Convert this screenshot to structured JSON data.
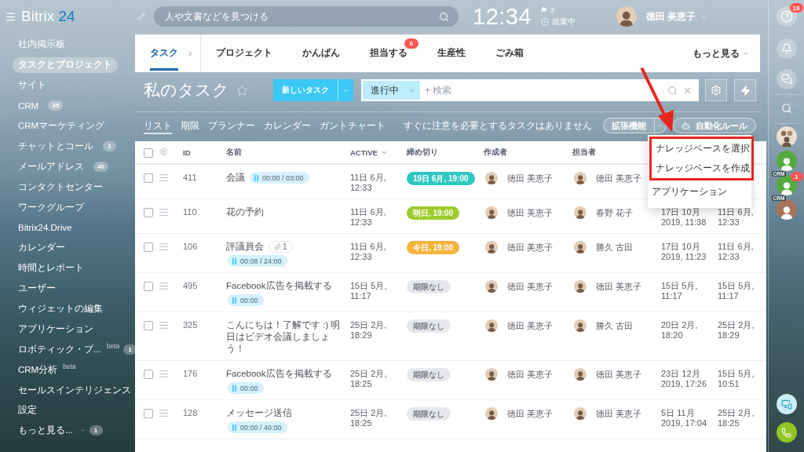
{
  "topbar": {
    "logo_word": "Bitrix",
    "logo_number": "24",
    "search": {
      "placeholder": "人や文書などを見つける"
    },
    "clock": "12:34",
    "flag_count": "3",
    "work_status": "就業中",
    "user_name": "徳田 美恵子"
  },
  "sidebar": {
    "items": [
      {
        "label": "社内掲示板",
        "kind": "link",
        "selected": false
      },
      {
        "label": "タスクとプロジェクト",
        "kind": "link",
        "selected": true
      },
      {
        "label": "サイト",
        "kind": "link",
        "selected": false
      },
      {
        "label": "CRM",
        "kind": "link",
        "selected": false,
        "counter": "35"
      },
      {
        "label": "CRMマーケティング",
        "kind": "link",
        "selected": false
      },
      {
        "label": "チャットとコール",
        "kind": "link",
        "selected": false,
        "counter": "1"
      },
      {
        "label": "メールアドレス",
        "kind": "link",
        "selected": false,
        "counter": "40"
      },
      {
        "label": "コンタクトセンター",
        "kind": "link",
        "selected": false
      },
      {
        "label": "ワークグループ",
        "kind": "link",
        "selected": false
      },
      {
        "label": "Bitrix24.Drive",
        "kind": "link",
        "selected": false
      },
      {
        "label": "カレンダー",
        "kind": "link",
        "selected": false
      },
      {
        "label": "時間とレポート",
        "kind": "link",
        "selected": false
      },
      {
        "label": "ユーザー",
        "kind": "link",
        "selected": false
      },
      {
        "label": "ウィジェットの編集",
        "kind": "link",
        "selected": false
      },
      {
        "label": "アプリケーション",
        "kind": "link",
        "selected": false
      },
      {
        "label": "ロボティック・プ...",
        "kind": "link",
        "selected": false,
        "tag": "beta",
        "counter": "1"
      },
      {
        "label": "CRM分析",
        "kind": "link",
        "selected": false,
        "tag": "beta"
      },
      {
        "label": "セールスインテリジェンス",
        "kind": "link",
        "selected": false
      },
      {
        "label": "設定",
        "kind": "link",
        "selected": false
      },
      {
        "label": "もっと見る...",
        "kind": "more",
        "selected": false,
        "counter": "1"
      }
    ]
  },
  "tabs": {
    "items": [
      {
        "label": "タスク",
        "kind": "root",
        "selected": true
      },
      {
        "label": "プロジェクト",
        "kind": "tab",
        "selected": false
      },
      {
        "label": "かんばん",
        "kind": "tab",
        "selected": false
      },
      {
        "label": "担当する",
        "kind": "tab",
        "selected": false,
        "counter": "6"
      },
      {
        "label": "生産性",
        "kind": "tab",
        "selected": false
      },
      {
        "label": "ごみ箱",
        "kind": "tab",
        "selected": false
      }
    ],
    "more": "もっと見る"
  },
  "toolbar": {
    "title": "私のタスク",
    "starred": false,
    "new_task_button": "新しいタスク",
    "filter": {
      "tags": [
        "進行中"
      ],
      "placeholder": "+ 検索"
    }
  },
  "views": {
    "items": [
      {
        "label": "リスト",
        "selected": true
      },
      {
        "label": "期限",
        "selected": false
      },
      {
        "label": "プランナー",
        "selected": false
      },
      {
        "label": "カレンダー",
        "selected": false
      },
      {
        "label": "ガントチャート",
        "selected": false
      }
    ],
    "notice": "すぐに注意を必要とするタスクはありません",
    "extensions_button": "拡張機能",
    "automation_button": "自動化ルール"
  },
  "dropdown": {
    "items": [
      {
        "label": "ナレッジベースを選択",
        "highlighted": true
      },
      {
        "label": "ナレッジベースを作成",
        "highlighted": true
      },
      {
        "label": "アプリケーション",
        "highlighted": false
      }
    ]
  },
  "table": {
    "select_all_checked": false,
    "columns": [
      {
        "label": "ID",
        "sorted": false
      },
      {
        "label": "名前",
        "sorted": false
      },
      {
        "label": "ACTIVE",
        "sorted": true
      },
      {
        "label": "締め切り",
        "sorted": false
      },
      {
        "label": "作成者",
        "sorted": false
      },
      {
        "label": "担当者",
        "sorted": false
      }
    ],
    "rows": [
      {
        "checked": false,
        "id": "411",
        "name": "会議",
        "timer": "00:00 / 03:00",
        "active": "11日 6月,\n12:33",
        "deadline": {
          "text": "19日 6月, 19:00",
          "color": "#2fc7c2"
        },
        "creator": "徳田 美恵子",
        "responsible": "徳田 美恵子"
      },
      {
        "checked": false,
        "id": "110",
        "name": "花の予約",
        "active": "11日 6月,\n12:33",
        "deadline": {
          "text": "明日, 19:00",
          "color": "#9ccb2c"
        },
        "creator": "徳田 美恵子",
        "responsible": "春野 花子",
        "column_7": "17日 10月\n2019, 11:38",
        "column_8": "11日 6月,\n12:33"
      },
      {
        "checked": false,
        "id": "106",
        "name": "評議員会",
        "attachments": "1",
        "timer": "00:08 / 24:00",
        "active": "11日 6月,\n12:33",
        "deadline": {
          "text": "今日, 19:00",
          "color": "#f4b33c"
        },
        "creator": "徳田 美恵子",
        "responsible": "勝久 古田",
        "column_7": "17日 10月\n2019, 11:23",
        "column_8": "11日 6月,\n12:33"
      },
      {
        "checked": false,
        "id": "495",
        "name": "Facebook広告を掲載する",
        "timer": "00:00",
        "active": "15日 5月,\n11:17",
        "deadline": {
          "text": "期限なし",
          "color": "#e6e8eb"
        },
        "creator": "徳田 美恵子",
        "responsible": "徳田 美恵子",
        "column_7": "15日 5月,\n11:17",
        "column_8": "15日 5月,\n11:17"
      },
      {
        "checked": false,
        "id": "325",
        "name": "こんにちは！了解です :) 明日はビデオ会議しましょう！",
        "active": "25日 2月,\n18:29",
        "deadline": {
          "text": "期限なし",
          "color": "#e6e8eb"
        },
        "creator": "徳田 美恵子",
        "responsible": "勝久 古田",
        "column_7": "20日 2月,\n18:20",
        "column_8": "25日 2月,\n18:29"
      },
      {
        "checked": false,
        "id": "176",
        "name": "Facebook広告を掲載する",
        "timer": "00:00",
        "active": "25日 2月,\n18:25",
        "deadline": {
          "text": "期限なし",
          "color": "#e6e8eb"
        },
        "creator": "徳田 美恵子",
        "responsible": "徳田 美恵子",
        "column_7": "23日 12月\n2019, 17:26",
        "column_8": "15日 5月,\n10:51"
      },
      {
        "checked": false,
        "id": "128",
        "name": "メッセージ送信",
        "timer": "00:00 / 40:00",
        "active": "25日 2月,\n18:25",
        "deadline": {
          "text": "期限なし",
          "color": "#e6e8eb"
        },
        "creator": "徳田 美恵子",
        "responsible": "徳田 美恵子",
        "column_7": "5日 11月\n2019, 17:04",
        "column_8": "25日 2月,\n18:25"
      }
    ]
  },
  "right_rail": {
    "help_counter": "19",
    "contacts": [
      {
        "kind": "group"
      },
      {
        "kind": "user",
        "color": "#56a93c"
      },
      {
        "kind": "crm",
        "color": "#56a93c",
        "tag": "CRM",
        "counter": "1"
      },
      {
        "kind": "crm",
        "color": "#a8735a",
        "tag": "CRM"
      }
    ]
  }
}
